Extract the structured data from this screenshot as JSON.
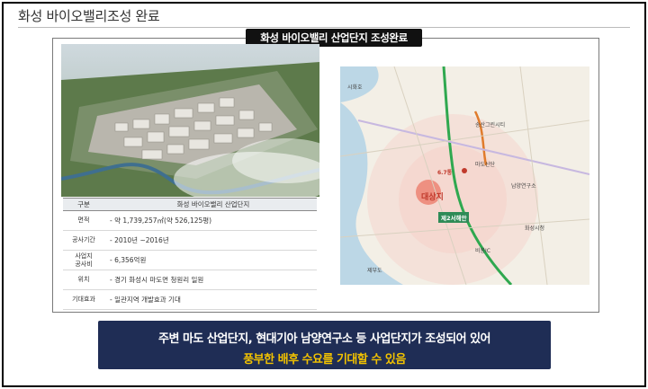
{
  "page": {
    "heading": "화성 바이오밸리조성 완료"
  },
  "banner": {
    "title": "화성 바이오밸리 산업단지 조성완료"
  },
  "info_table": {
    "header": {
      "key": "구분",
      "value": "화성 바이오밸리 산업단지"
    },
    "rows": [
      {
        "key": "면적",
        "value": "- 약 1,739,257㎡(약 526,125평)"
      },
      {
        "key": "공사기간",
        "value": "- 2010년 ~2016년"
      },
      {
        "key": "사업지\n공사비",
        "value": "- 6,356억원"
      },
      {
        "key": "위치",
        "value": "- 경기 화성시 마도면 청원리 일원"
      },
      {
        "key": "기대효과",
        "value": "- 일관지역 개발효과 기대"
      }
    ]
  },
  "map": {
    "target_label": "대상지",
    "bridge_tag": "제2서해안",
    "poi_label": "6.7통",
    "labels": [
      "시화호",
      "송산그린시티",
      "마도산단",
      "남양연구소",
      "화성시청",
      "비봉IC",
      "제부도"
    ]
  },
  "callout": {
    "line1": "주변 마도 산업단지, 현대기아 남양연구소 등 사업단지가 조성되어 있어",
    "line2": "풍부한 배후 수요를 기대할 수 있음"
  },
  "colors": {
    "callout_bg": "#1f2d55",
    "callout_highlight": "#f2c200",
    "banner_bg": "#111111",
    "target_red": "#c0392b"
  }
}
